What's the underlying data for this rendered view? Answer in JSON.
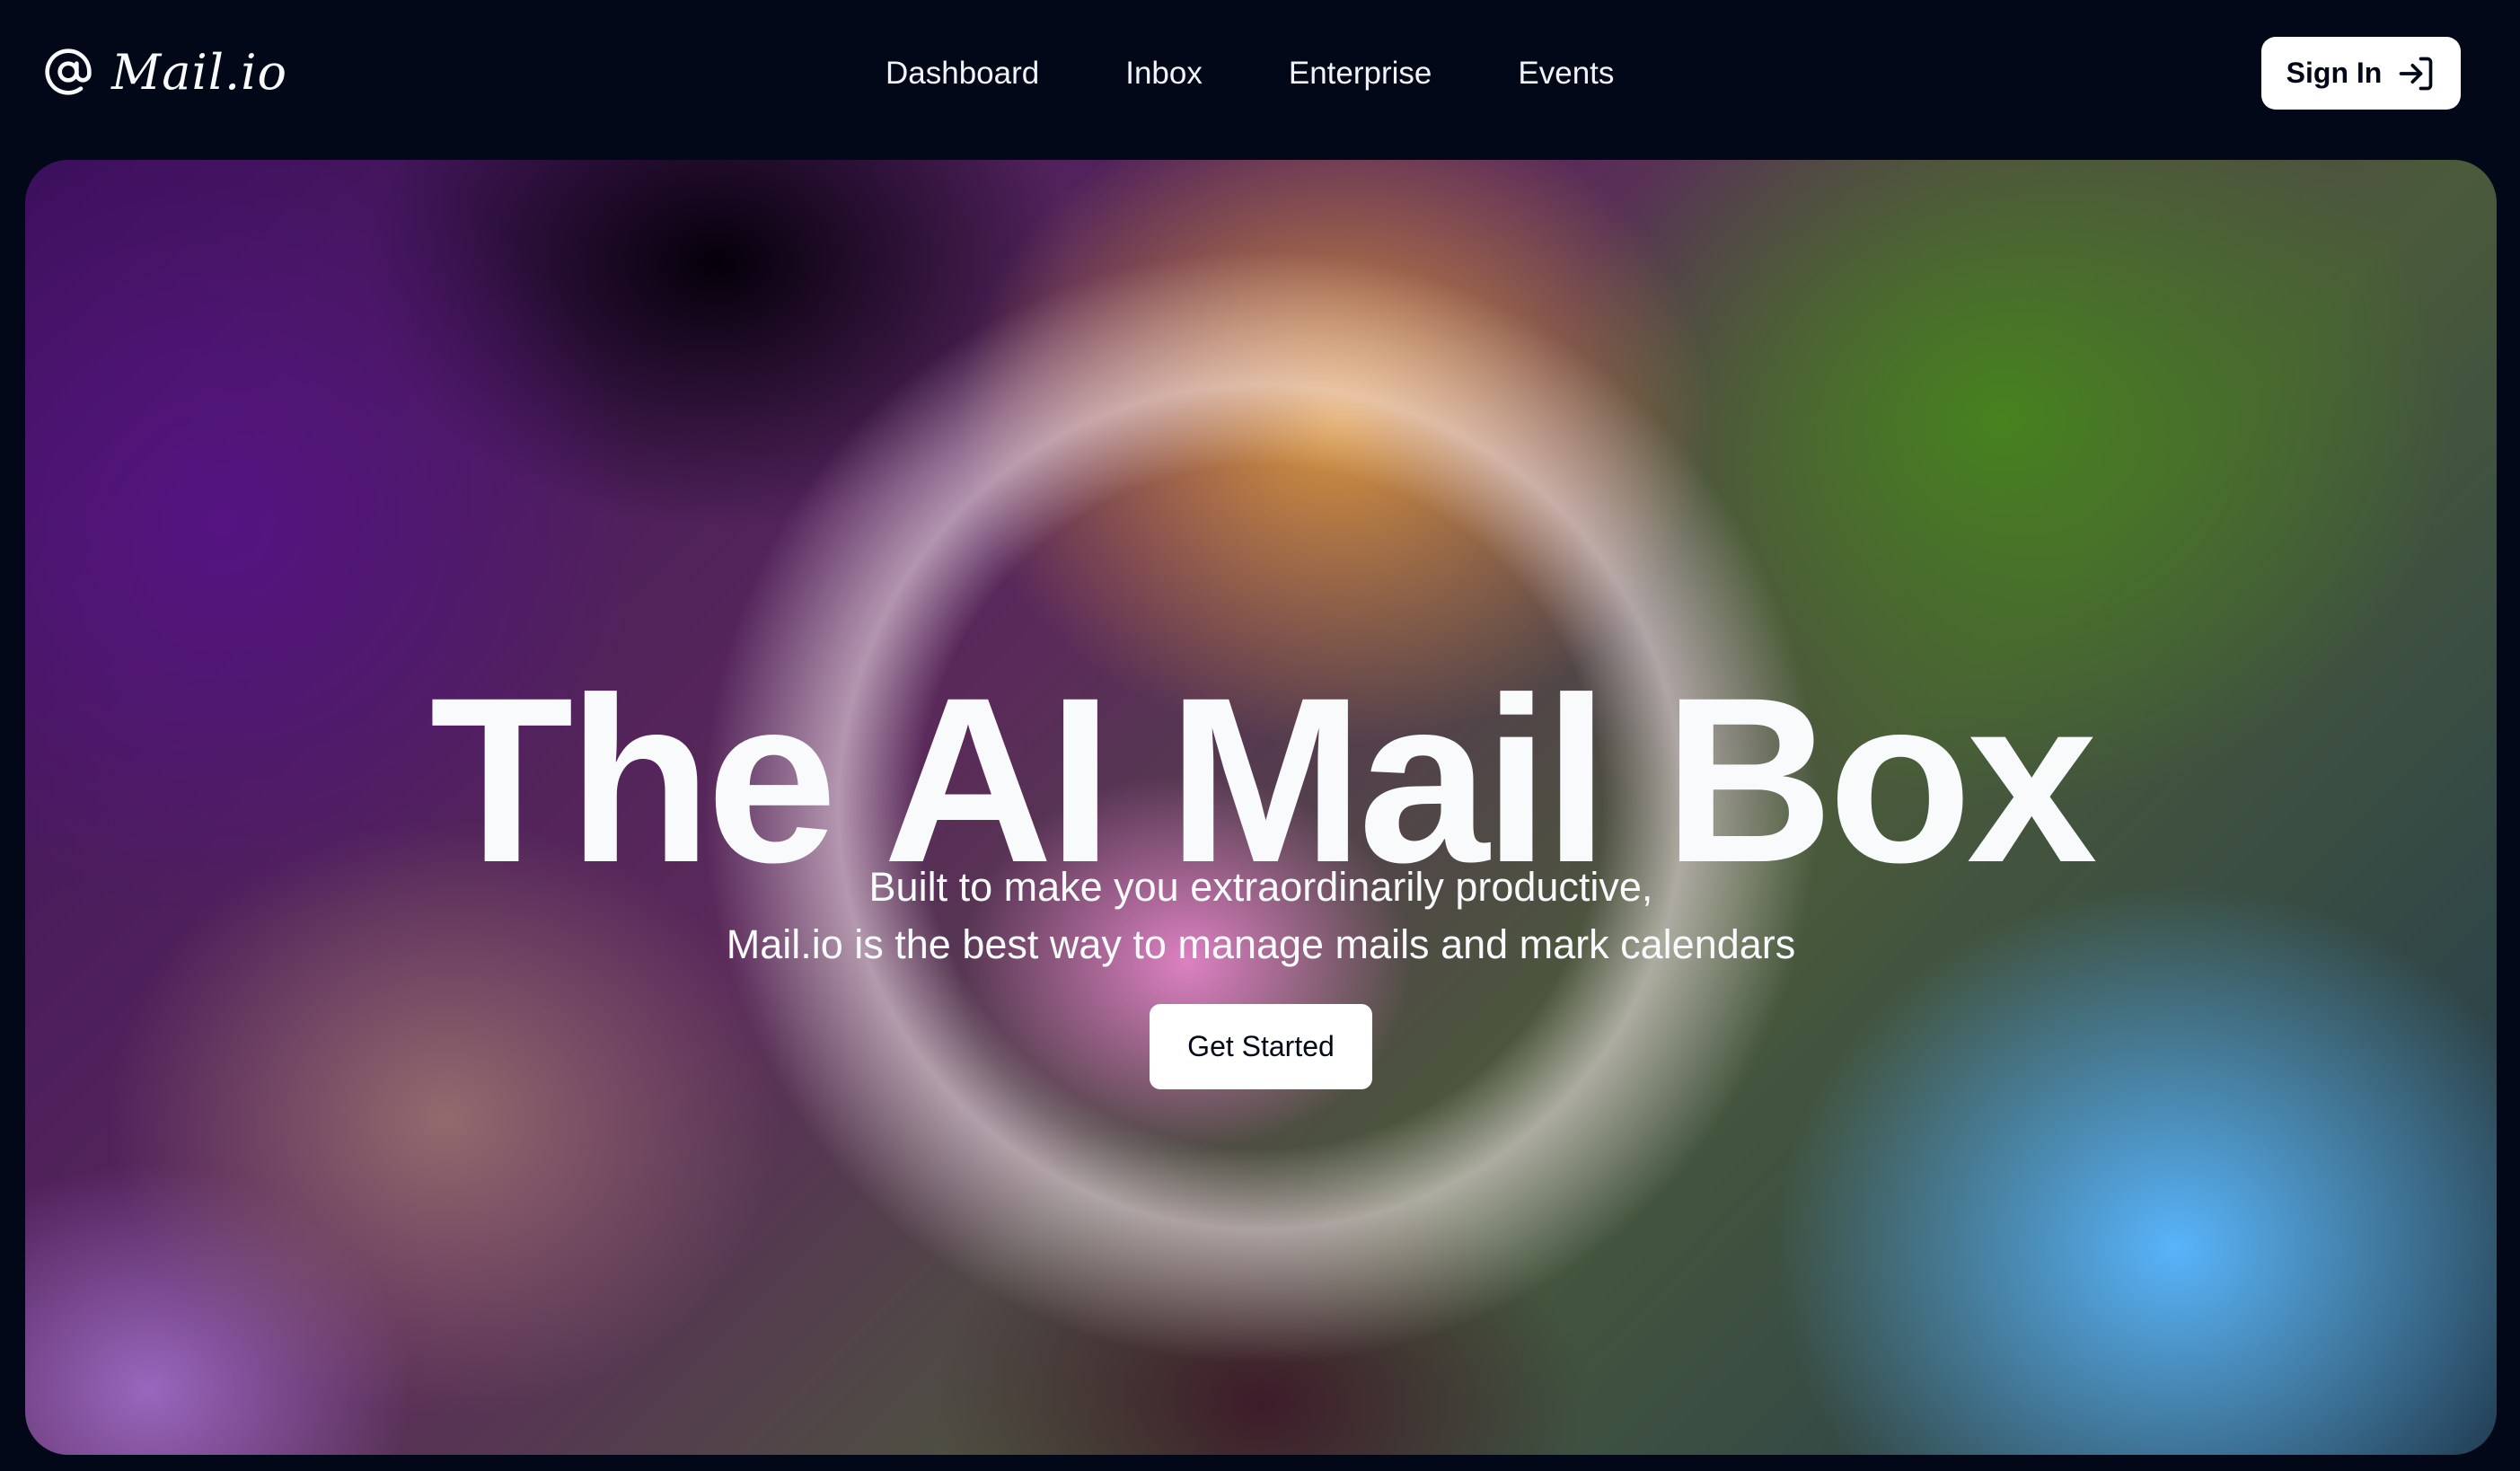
{
  "brand": {
    "icon": "at-sign-icon",
    "name": "Mail.io"
  },
  "nav": {
    "items": [
      {
        "label": "Dashboard"
      },
      {
        "label": "Inbox"
      },
      {
        "label": "Enterprise"
      },
      {
        "label": "Events"
      }
    ]
  },
  "header": {
    "signin_label": "Sign In",
    "signin_icon": "sign-in-arrow-icon"
  },
  "hero": {
    "title": "The AI Mail Box",
    "subtitle_line1": "Built to make you extraordinarily productive,",
    "subtitle_line2": "Mail.io is the best way to manage mails and mark calendars",
    "cta_label": "Get Started"
  },
  "colors": {
    "page_background": "#020817",
    "text_light": "#f8fafc",
    "button_background": "#ffffff",
    "button_text": "#020817"
  }
}
